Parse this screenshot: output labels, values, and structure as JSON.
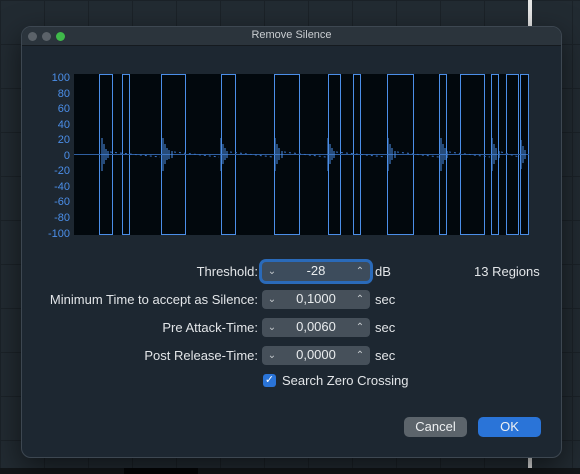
{
  "window": {
    "title": "Remove Silence"
  },
  "waveform": {
    "y_axis_labels": [
      "100",
      "80",
      "60",
      "40",
      "20",
      "0",
      "-20",
      "-40",
      "-60",
      "-80",
      "-100"
    ],
    "region_count": 13
  },
  "fields": {
    "threshold": {
      "label": "Threshold:",
      "value": "-28",
      "unit": "dB"
    },
    "min_time": {
      "label": "Minimum Time to accept as Silence:",
      "value": "0,1000",
      "unit": "sec"
    },
    "pre_attack": {
      "label": "Pre Attack-Time:",
      "value": "0,0060",
      "unit": "sec"
    },
    "post_release": {
      "label": "Post Release-Time:",
      "value": "0,0000",
      "unit": "sec"
    }
  },
  "regions_text": "13 Regions",
  "search_zero_crossing": {
    "label": "Search Zero Crossing",
    "checked": true
  },
  "buttons": {
    "cancel": "Cancel",
    "ok": "OK"
  },
  "colors": {
    "accent": "#2a74d8",
    "waveform": "#4b8ee8",
    "window_bg": "#1d2731"
  },
  "icons": {
    "stepper_down": "chevron-down-icon",
    "stepper_up": "chevron-up-icon",
    "checkbox": "checkmark-icon"
  }
}
